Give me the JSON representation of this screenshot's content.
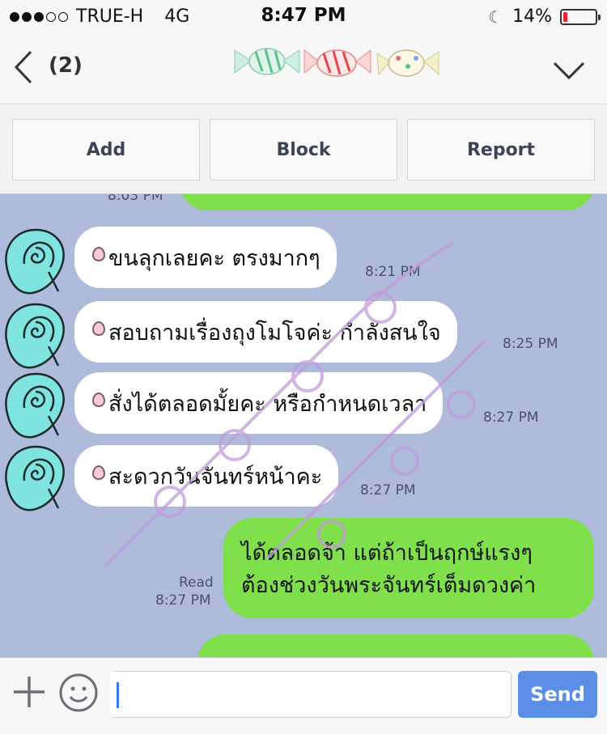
{
  "status_bar": {
    "carrier": "TRUE-H",
    "network": "4G",
    "time": "8:47 PM",
    "battery_percent": "14%",
    "battery_level": 0.14,
    "signal_filled": 3,
    "signal_total": 5
  },
  "header": {
    "count": "(2)"
  },
  "actions": {
    "add": "Add",
    "block": "Block",
    "report": "Report"
  },
  "messages": {
    "partial_top_time": "8:03 PM",
    "m1": {
      "text": "ขนลุกเลยคะ ตรงมากๆ",
      "time": "8:21 PM"
    },
    "m2": {
      "text": "สอบถามเรื่องถุงโมโจค่ะ กำลังสนใจ",
      "time": "8:25 PM"
    },
    "m3": {
      "text": "สั่งได้ตลอดมั้ยคะ หรือกำหนดเวลา",
      "time": "8:27 PM"
    },
    "m4": {
      "text": "สะดวกวันจันทร์หน้าคะ",
      "time": "8:27 PM"
    },
    "reply": {
      "line1": "ได้ตลอดจ้า แต่ถ้าเป็นฤกษ์แรงๆ",
      "line2": "ต้องช่วงวันพระจันทร์เต็มดวงค่า",
      "read": "Read",
      "time": "8:27 PM"
    }
  },
  "input": {
    "placeholder": "",
    "send": "Send"
  },
  "colors": {
    "chat_bg": "#aebbdb",
    "outgoing_bubble": "#80e04c",
    "send_button": "#5b8ee6",
    "watermark": "#c29bdc"
  }
}
